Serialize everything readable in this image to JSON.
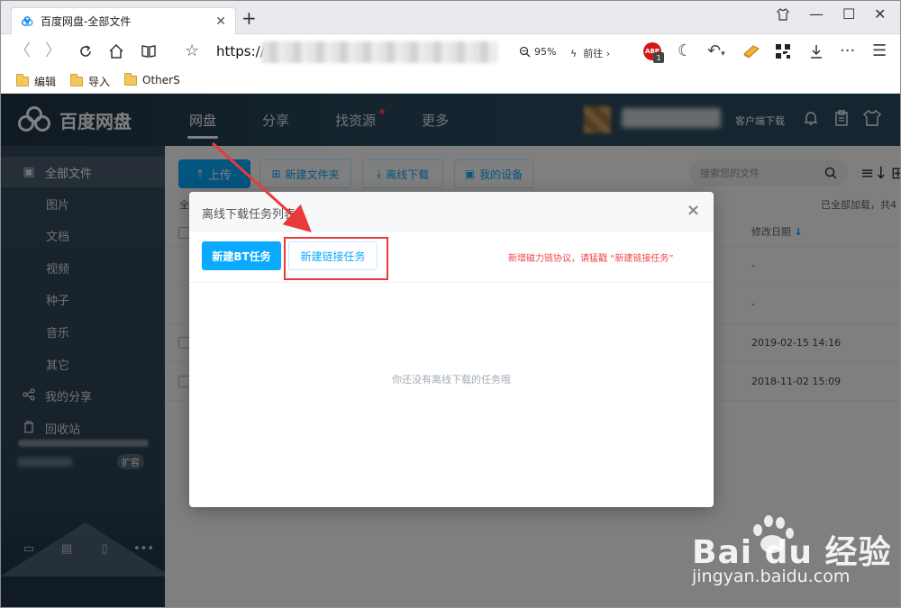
{
  "browser": {
    "tab_title": "百度网盘-全部文件",
    "url_prefix": "https://",
    "zoom": "95%",
    "goto_label": "前往",
    "abp_label": "ABP",
    "abp_badge": "1",
    "bookmarks": [
      "编辑",
      "导入",
      "OtherS"
    ]
  },
  "header": {
    "logo_text": "百度网盘",
    "nav": [
      {
        "label": "网盘",
        "active": true
      },
      {
        "label": "分享",
        "active": false
      },
      {
        "label": "找资源",
        "active": false
      },
      {
        "label": "更多",
        "active": false
      }
    ],
    "client_download": "客户端下载"
  },
  "sidebar": {
    "items": [
      {
        "label": "全部文件",
        "icon": "file-icon",
        "active": true
      },
      {
        "label": "图片",
        "sub": true
      },
      {
        "label": "文档",
        "sub": true
      },
      {
        "label": "视频",
        "sub": true
      },
      {
        "label": "种子",
        "sub": true
      },
      {
        "label": "音乐",
        "sub": true
      },
      {
        "label": "其它",
        "sub": true
      },
      {
        "label": "我的分享",
        "icon": "share-icon"
      },
      {
        "label": "回收站",
        "icon": "trash-icon"
      }
    ],
    "expand_label": "扩容"
  },
  "main": {
    "upload_label": "上传",
    "new_folder_label": "新建文件夹",
    "offline_download_label": "离线下载",
    "my_devices_label": "我的设备",
    "search_placeholder": "搜索您的文件",
    "list_label": "全",
    "status_text": "已全部加载，共4",
    "date_column": "修改日期",
    "sort_arrow": "↓",
    "rows": [
      {
        "date": "-"
      },
      {
        "date": "-"
      },
      {
        "date": "2019-02-15 14:16"
      },
      {
        "date": "2018-11-02 15:09"
      }
    ]
  },
  "modal": {
    "title": "离线下载任务列表",
    "close": "×",
    "new_bt_label": "新建BT任务",
    "new_link_label": "新建链接任务",
    "tip": "新增磁力链协议，请猛戳 “新建链接任务”",
    "empty_text": "你还没有离线下载的任务哦"
  },
  "colors": {
    "accent": "#09aaff",
    "header_bg": "#2b4a5e",
    "highlight": "#e83a3a"
  },
  "watermark": {
    "brand": "Bai du 经验",
    "url": "jingyan.baidu.com"
  }
}
